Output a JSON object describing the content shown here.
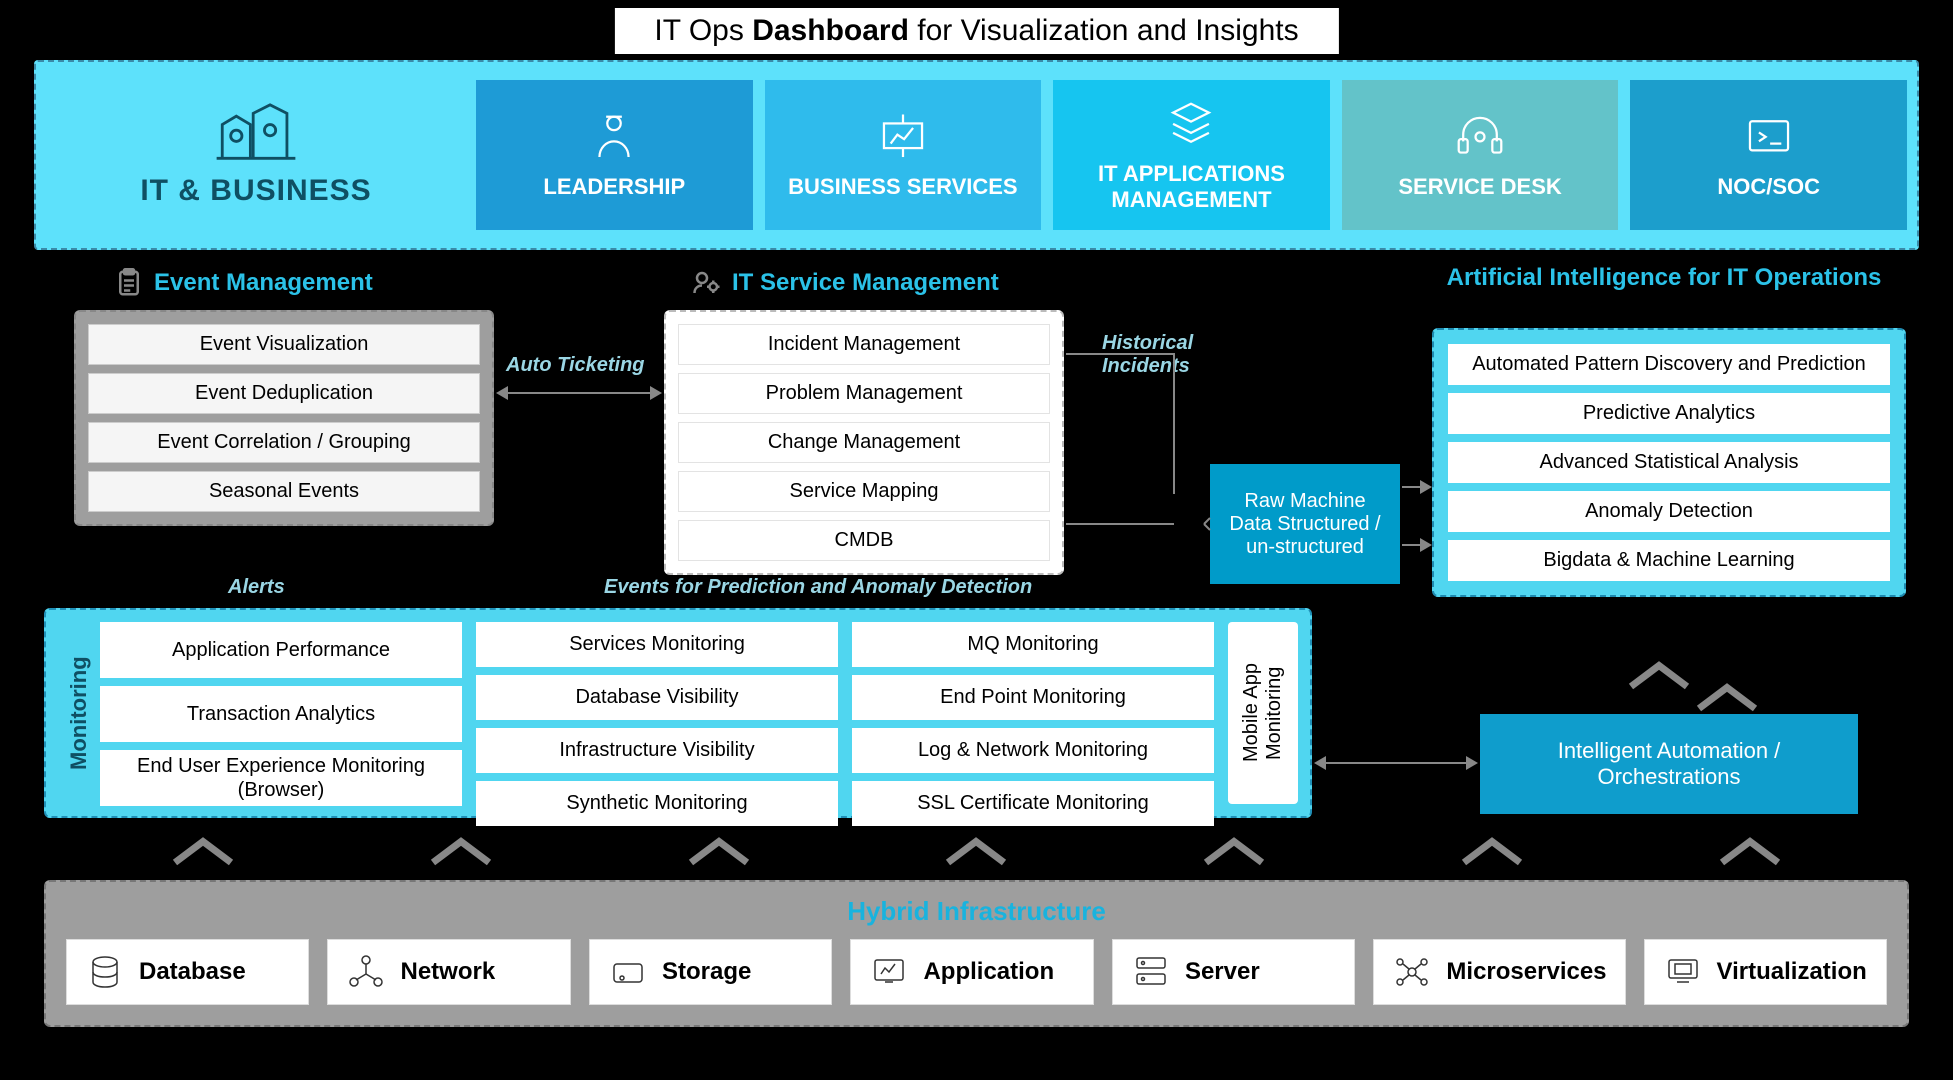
{
  "title_prefix": "IT Ops ",
  "title_bold": "Dashboard",
  "title_suffix": " for Visualization and Insights",
  "it_business": "IT & BUSINESS",
  "tiles": {
    "leadership": "LEADERSHIP",
    "business": "BUSINESS SERVICES",
    "apps": "IT APPLICATIONS MANAGEMENT",
    "desk": "SERVICE DESK",
    "noc": "NOC/SOC"
  },
  "sections": {
    "event": "Event Management",
    "itsm": "IT Service Management",
    "ai": "Artificial Intelligence for IT Operations",
    "monitoring": "Monitoring",
    "hybrid": "Hybrid Infrastructure"
  },
  "event_items": [
    "Event Visualization",
    "Event Deduplication",
    "Event Correlation / Grouping",
    "Seasonal Events"
  ],
  "itsm_items": [
    "Incident Management",
    "Problem Management",
    "Change Management",
    "Service Mapping",
    "CMDB"
  ],
  "ai_items": [
    "Automated Pattern Discovery and Prediction",
    "Predictive Analytics",
    "Advanced Statistical Analysis",
    "Anomaly Detection",
    "Bigdata & Machine Learning"
  ],
  "mon_col1": [
    "Application Performance",
    "Transaction Analytics",
    "End User Experience Monitoring (Browser)"
  ],
  "mon_col2": [
    "Services Monitoring",
    "Database Visibility",
    "Infrastructure Visibility",
    "Synthetic Monitoring"
  ],
  "mon_col3": [
    "MQ Monitoring",
    "End Point Monitoring",
    "Log & Network Monitoring",
    "SSL Certificate Monitoring"
  ],
  "mon_mobile": "Mobile App Monitoring",
  "labels": {
    "auto_ticketing": "Auto Ticketing",
    "historical": "Historical Incidents",
    "alerts": "Alerts",
    "events_pred": "Events for Prediction and Anomaly Detection",
    "raw": "Raw Machine Data Structured / un-structured",
    "automation": "Intelligent Automation / Orchestrations"
  },
  "infra": [
    "Database",
    "Network",
    "Storage",
    "Application",
    "Server",
    "Microservices",
    "Virtualization"
  ]
}
